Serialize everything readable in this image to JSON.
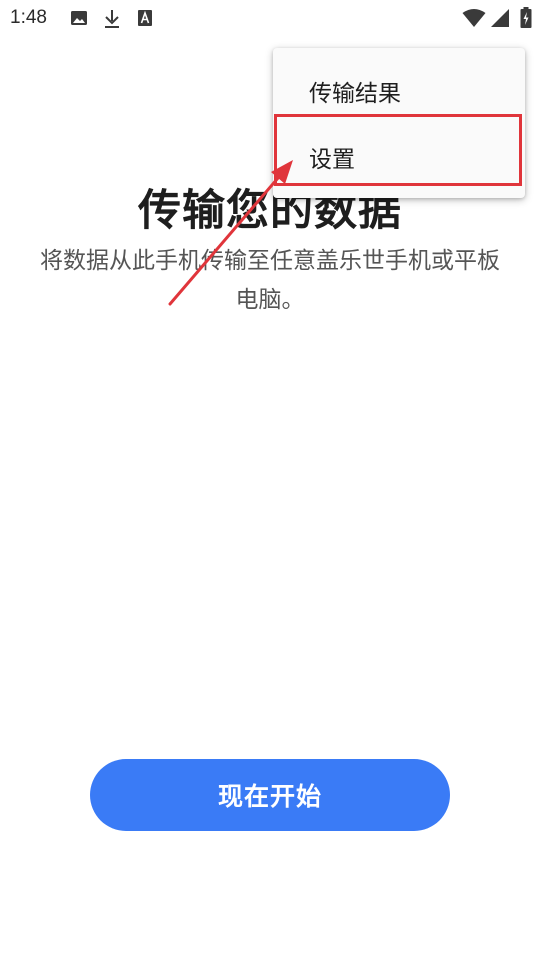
{
  "status_bar": {
    "time": "1:48",
    "icons": [
      "image-icon",
      "download-icon",
      "font-icon",
      "wifi-icon",
      "signal-icon",
      "battery-charging-icon"
    ]
  },
  "main": {
    "title": "传输您的数据",
    "subtitle": "将数据从此手机传输至任意盖乐世手机或平板电脑。",
    "start_button_label": "现在开始"
  },
  "menu": {
    "items": [
      {
        "label": "传输结果"
      },
      {
        "label": "设置"
      }
    ]
  },
  "colors": {
    "accent": "#3a7bf6",
    "annotation": "#e0353b",
    "text_primary": "#1e1e1e",
    "text_secondary": "#555555"
  }
}
